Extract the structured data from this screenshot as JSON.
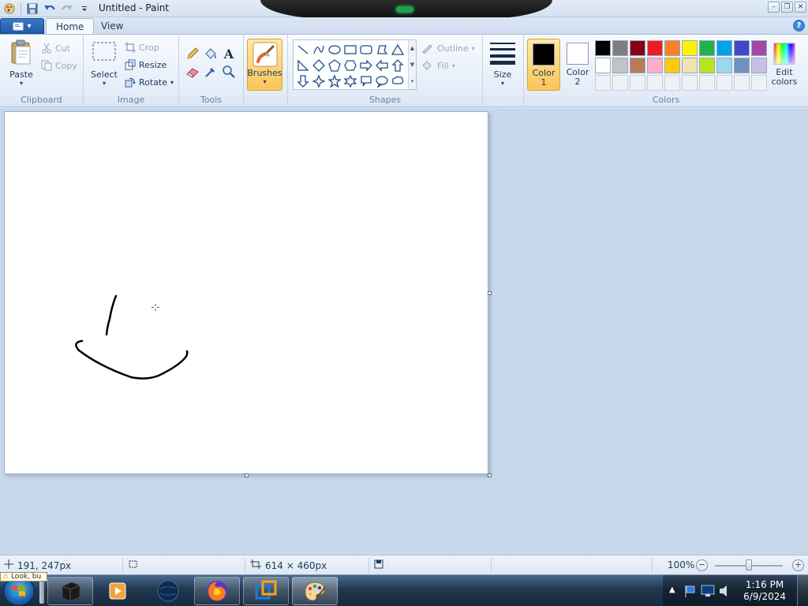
{
  "window": {
    "title": "Untitled - Paint"
  },
  "tabs": {
    "home": "Home",
    "view": "View"
  },
  "clipboard": {
    "paste": "Paste",
    "cut": "Cut",
    "copy": "Copy",
    "group": "Clipboard"
  },
  "image": {
    "select": "Select",
    "crop": "Crop",
    "resize": "Resize",
    "rotate": "Rotate",
    "group": "Image"
  },
  "tools": {
    "group": "Tools"
  },
  "brushes": {
    "label": "Brushes"
  },
  "shapes": {
    "outline": "Outline",
    "fill": "Fill",
    "group": "Shapes"
  },
  "size": {
    "label": "Size"
  },
  "colors": {
    "color1_line1": "Color",
    "color1_line2": "1",
    "color2_line1": "Color",
    "color2_line2": "2",
    "edit_line1": "Edit",
    "edit_line2": "colors",
    "group": "Colors",
    "color1_value": "#000000",
    "color2_value": "#ffffff",
    "palette_row1": [
      "#000000",
      "#7f7f7f",
      "#880015",
      "#ed1c24",
      "#ff7f27",
      "#fff200",
      "#22b14c",
      "#00a2e8",
      "#3f48cc",
      "#a349a4"
    ],
    "palette_row2": [
      "#ffffff",
      "#c3c3c3",
      "#b97a57",
      "#ffaec9",
      "#ffc90e",
      "#efe4b0",
      "#b5e61d",
      "#99d9ea",
      "#7092be",
      "#c8bfe7"
    ]
  },
  "status": {
    "cursor": "191, 247px",
    "canvas_size": "614 × 460px",
    "zoom": "100%",
    "zoom_fraction": 0.5
  },
  "taskbar": {
    "time": "1:16 PM",
    "date": "6/9/2024",
    "tooltip": "Look, bu"
  }
}
